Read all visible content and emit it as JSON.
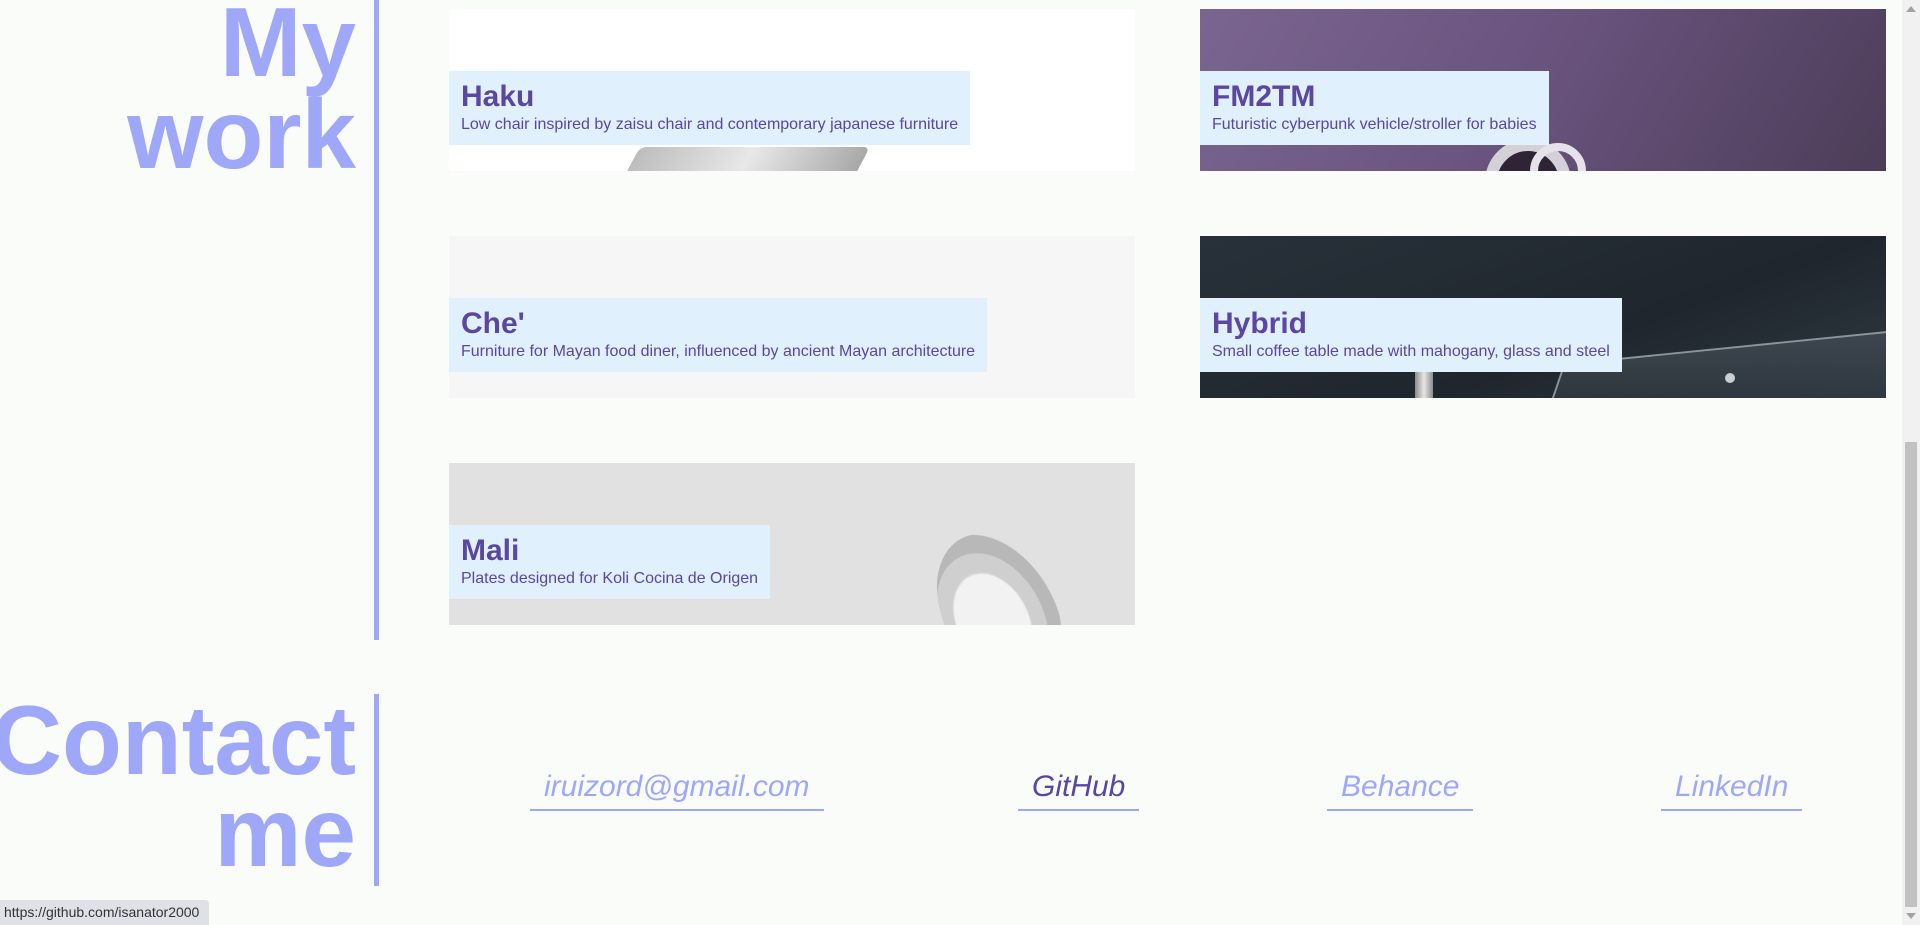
{
  "work_section": {
    "title_line1": "My",
    "title_line2": "work",
    "projects": [
      {
        "name": "Haku",
        "description": "Low chair inspired by zaisu chair and contemporary japanese furniture"
      },
      {
        "name": "FM2TM",
        "description": "Futuristic cyberpunk vehicle/stroller for babies"
      },
      {
        "name": "Che'",
        "description": "Furniture for Mayan food diner, influenced by ancient Mayan architecture"
      },
      {
        "name": "Hybrid",
        "description": "Small coffee table made with mahogany, glass and steel"
      },
      {
        "name": "Mali",
        "description": "Plates designed for Koli Cocina de Origen"
      }
    ]
  },
  "contact_section": {
    "title_line1": "Contact",
    "title_line2": "me",
    "links": {
      "email": "iruizord@gmail.com",
      "github": "GitHub",
      "behance": "Behance",
      "linkedin": "LinkedIn"
    }
  },
  "status_bar": {
    "url": "https://github.com/isanator2000"
  },
  "colors": {
    "accent": "#9fa8f8",
    "label_bg": "#e0f0fd",
    "label_text": "#5b46a0",
    "background": "#f9fcf8"
  }
}
